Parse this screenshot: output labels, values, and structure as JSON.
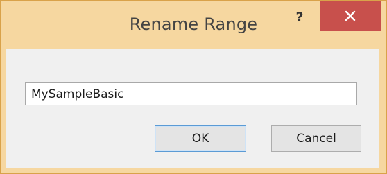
{
  "window": {
    "title": "Rename Range",
    "help_label": "?",
    "close_icon": "close-icon"
  },
  "form": {
    "name_value": "MySampleBasic"
  },
  "buttons": {
    "ok_label": "OK",
    "cancel_label": "Cancel"
  },
  "colors": {
    "frame": "#f6d7a0",
    "close_button": "#c8504c",
    "client_background": "#f0f0f0",
    "default_button_border": "#5b9bd5"
  }
}
